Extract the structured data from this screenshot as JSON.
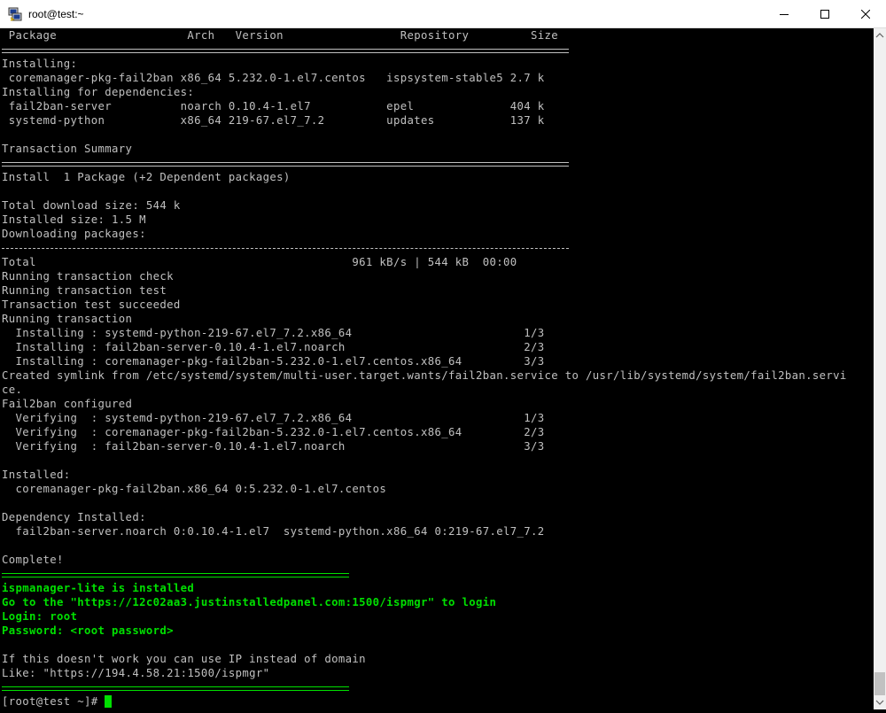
{
  "window": {
    "title": "root@test:~"
  },
  "terminal": {
    "lines": [
      " Package                   Arch   Version                 Repository         Size",
      "",
      "Installing:",
      " coremanager-pkg-fail2ban x86_64 5.232.0-1.el7.centos   ispsystem-stable5 2.7 k",
      "Installing for dependencies:",
      " fail2ban-server          noarch 0.10.4-1.el7           epel              404 k",
      " systemd-python           x86_64 219-67.el7_7.2         updates           137 k",
      "",
      "Transaction Summary",
      "",
      "Install  1 Package (+2 Dependent packages)",
      "",
      "Total download size: 544 k",
      "Installed size: 1.5 M",
      "Downloading packages:",
      "",
      "Total                                              961 kB/s | 544 kB  00:00",
      "Running transaction check",
      "Running transaction test",
      "Transaction test succeeded",
      "Running transaction",
      "  Installing : systemd-python-219-67.el7_7.2.x86_64                         1/3",
      "  Installing : fail2ban-server-0.10.4-1.el7.noarch                          2/3",
      "  Installing : coremanager-pkg-fail2ban-5.232.0-1.el7.centos.x86_64         3/3",
      "Created symlink from /etc/systemd/system/multi-user.target.wants/fail2ban.service to /usr/lib/systemd/system/fail2ban.servi",
      "ce.",
      "Fail2ban configured",
      "  Verifying  : systemd-python-219-67.el7_7.2.x86_64                         1/3",
      "  Verifying  : coremanager-pkg-fail2ban-5.232.0-1.el7.centos.x86_64         2/3",
      "  Verifying  : fail2ban-server-0.10.4-1.el7.noarch                          3/3",
      "",
      "Installed:",
      "  coremanager-pkg-fail2ban.x86_64 0:5.232.0-1.el7.centos",
      "",
      "Dependency Installed:",
      "  fail2ban-server.noarch 0:0.10.4-1.el7  systemd-python.x86_64 0:219-67.el7_7.2",
      "",
      "Complete!",
      "",
      "ispmanager-lite is installed",
      "Go to the \"https://12c02aa3.justinstalledpanel.com:1500/ispmgr\" to login",
      "Login: root",
      "Password: <root password>",
      "",
      "If this doesn't work you can use IP instead of domain",
      "Like: \"https://194.4.58.21:1500/ispmgr\"",
      "",
      "[root@test ~]# "
    ]
  }
}
